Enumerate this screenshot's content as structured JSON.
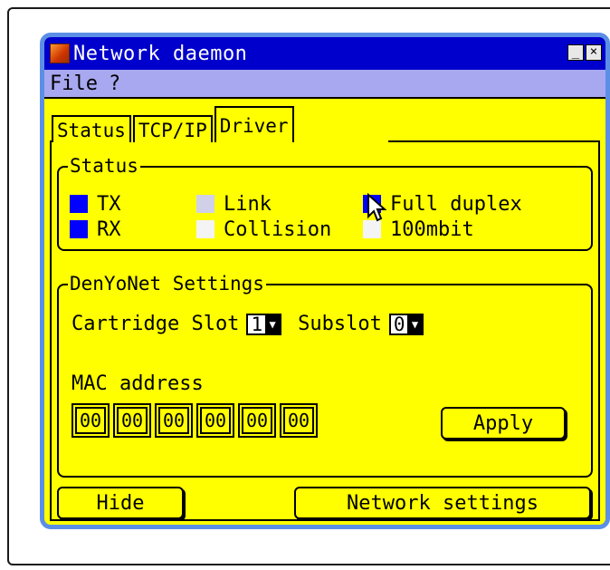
{
  "window": {
    "title": "Network daemon",
    "minimize_label": "_",
    "close_label": "×"
  },
  "menu": [
    "File",
    "?"
  ],
  "tabs": [
    {
      "label": "Status",
      "active": false
    },
    {
      "label": "TCP/IP",
      "active": false
    },
    {
      "label": "Driver",
      "active": true
    }
  ],
  "status": {
    "group_label": "Status",
    "leds": [
      {
        "label": "TX",
        "color": "#0000ff"
      },
      {
        "label": "Link",
        "color": "#d0d0e8"
      },
      {
        "label": "Full duplex",
        "color": "#0000ff"
      },
      {
        "label": "RX",
        "color": "#0000ff"
      },
      {
        "label": "Collision",
        "color": "#f4f4f4"
      },
      {
        "label": "100mbit",
        "color": "#f4f4f4"
      }
    ]
  },
  "settings": {
    "group_label": "DenYoNet Settings",
    "cartridge_slot_label": "Cartridge Slot",
    "cartridge_slot_value": "1",
    "subslot_label": "Subslot",
    "subslot_value": "0",
    "mac_label": "MAC address",
    "mac": [
      "00",
      "00",
      "00",
      "00",
      "00",
      "00"
    ],
    "apply_label": "Apply"
  },
  "buttons": {
    "hide": "Hide",
    "network_settings": "Network settings"
  },
  "colors": {
    "window_bg": "#ffff00",
    "titlebar": "#0000cc",
    "menubar": "#a8a8f0",
    "frame": "#5b8fe6"
  }
}
